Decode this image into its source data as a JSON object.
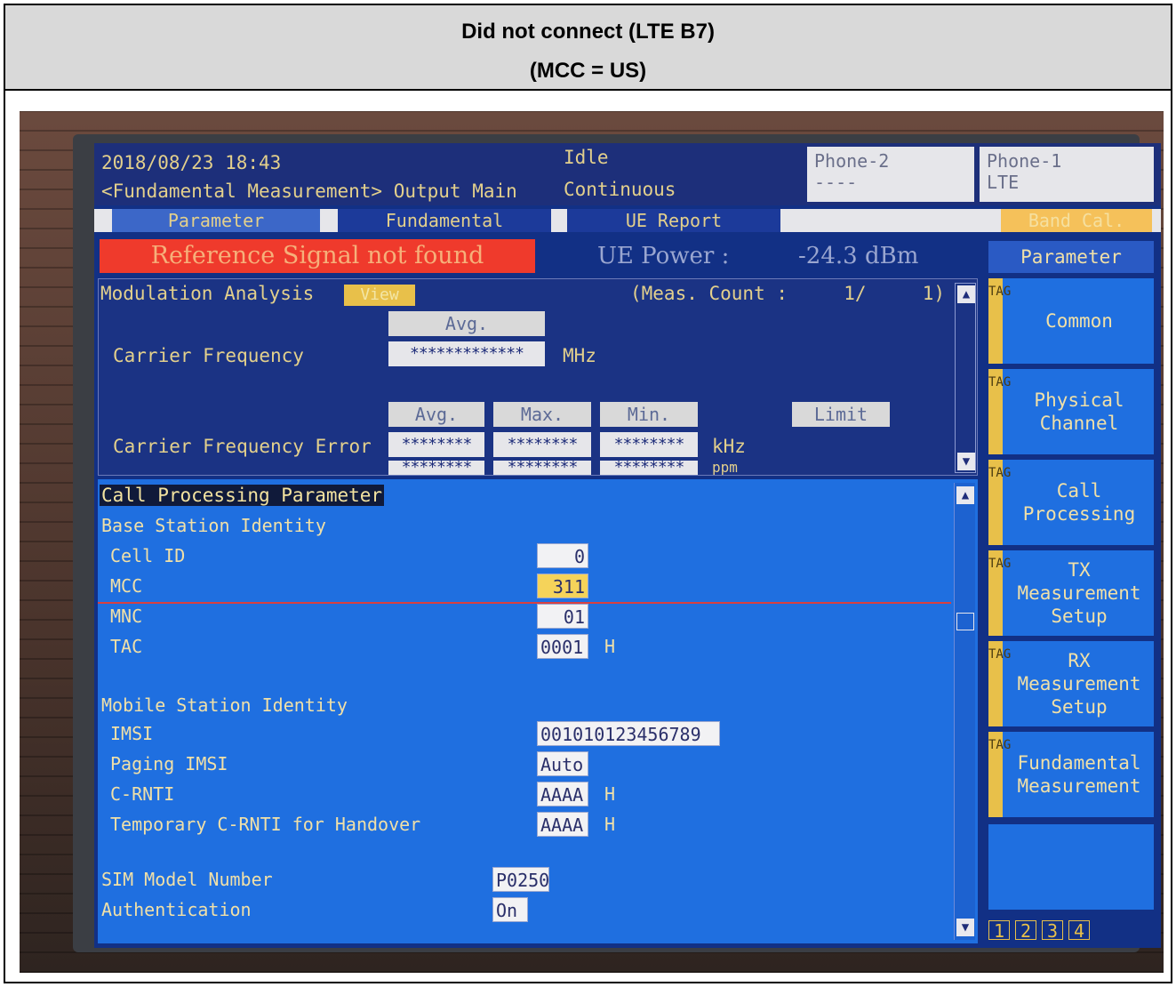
{
  "header": {
    "title": "Did not connect (LTE B7)",
    "subtitle": "(MCC = US)"
  },
  "status": {
    "datetime": "2018/08/23 18:43",
    "screen": "<Fundamental Measurement> Output Main",
    "state_line1": "Idle",
    "state_line2": "Continuous",
    "phone2_label": "Phone-2",
    "phone2_value": "----",
    "phone1_label": "Phone-1",
    "phone1_value": "LTE"
  },
  "tabs": {
    "parameter": "Parameter",
    "fundamental": "Fundamental",
    "ue_report": "UE Report",
    "band_cal": "Band Cal."
  },
  "signal": {
    "alert": "Reference Signal not found",
    "ue_power_label": "UE Power :",
    "ue_power_value": "-24.3 dBm"
  },
  "modulation": {
    "title": "Modulation Analysis",
    "view_label": "View",
    "meas_count": "(Meas. Count :     1/     1)",
    "avg_header": "Avg.",
    "carrier_freq_label": "Carrier Frequency",
    "carrier_freq_value": "*************",
    "carrier_freq_unit": "MHz",
    "col_avg": "Avg.",
    "col_max": "Max.",
    "col_min": "Min.",
    "limit_label": "Limit",
    "cfe_label": "Carrier Frequency Error",
    "cfe_avg": "********",
    "cfe_max": "********",
    "cfe_min": "********",
    "cfe_unit": "kHz",
    "cfe_avg2": "********",
    "cfe_max2": "********",
    "cfe_min2": "********",
    "cfe_unit2": "ppm"
  },
  "call_processing": {
    "title": "Call Processing Parameter",
    "bs_identity": "Base Station Identity",
    "cell_id_label": "Cell ID",
    "cell_id_value": "0",
    "mcc_label": "MCC",
    "mcc_value": "311",
    "mnc_label": "MNC",
    "mnc_value": "01",
    "tac_label": "TAC",
    "tac_value": "0001",
    "tac_unit": "H",
    "ms_identity": "Mobile Station Identity",
    "imsi_label": "IMSI",
    "imsi_value": "001010123456789",
    "paging_imsi_label": "Paging IMSI",
    "paging_imsi_value": "Auto",
    "crnti_label": "C-RNTI",
    "crnti_value": "AAAA",
    "crnti_unit": "H",
    "tcrnti_label": "Temporary C-RNTI for Handover",
    "tcrnti_value": "AAAA",
    "tcrnti_unit": "H",
    "sim_label": "SIM Model Number",
    "sim_value": "P0250",
    "auth_label": "Authentication",
    "auth_value": "On"
  },
  "side_menu": {
    "title": "Parameter",
    "tag": "TAG",
    "items": [
      {
        "label": "Common"
      },
      {
        "label": "Physical Channel"
      },
      {
        "label": "Call Processing"
      },
      {
        "label": "TX Measurement Setup"
      },
      {
        "label": "RX Measurement Setup"
      },
      {
        "label": "Fundamental Measurement"
      }
    ],
    "pages": [
      "1",
      "2",
      "3",
      "4"
    ]
  },
  "colors": {
    "alert": "#ef3a2c",
    "screen_bg": "#123085",
    "panel_bg": "#1f6fe0",
    "highlight": "#f5d35a"
  }
}
